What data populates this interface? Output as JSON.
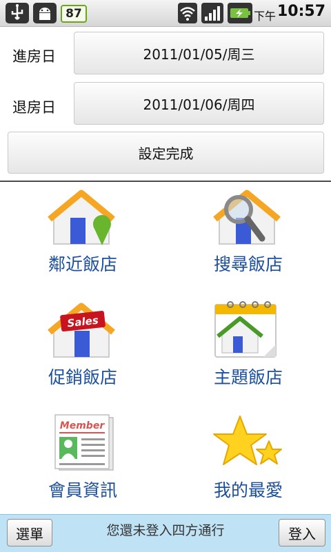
{
  "status_bar": {
    "battery_level": "87",
    "ampm": "下午",
    "time": "10:57",
    "icons": [
      "usb-icon",
      "android-debug-icon",
      "wifi-icon",
      "signal-icon",
      "battery-charging-icon"
    ]
  },
  "form": {
    "checkin_label": "進房日",
    "checkin_value": "2011/01/05/周三",
    "checkout_label": "退房日",
    "checkout_value": "2011/01/06/周四",
    "done_label": "設定完成"
  },
  "grid": {
    "nearby": "鄰近飯店",
    "search": "搜尋飯店",
    "promo": "促銷飯店",
    "promo_badge": "Sales",
    "theme": "主題飯店",
    "member": "會員資訊",
    "member_badge": "Member",
    "favorite": "我的最愛"
  },
  "bottom_bar": {
    "menu_label": "選單",
    "message": "您還未登入四方通行",
    "login_label": "登入"
  },
  "colors": {
    "label_blue": "#1b4f9c",
    "roof_orange": "#f5a623",
    "door_blue": "#3b5bd6",
    "bottom_bar": "#bfe2f5"
  }
}
